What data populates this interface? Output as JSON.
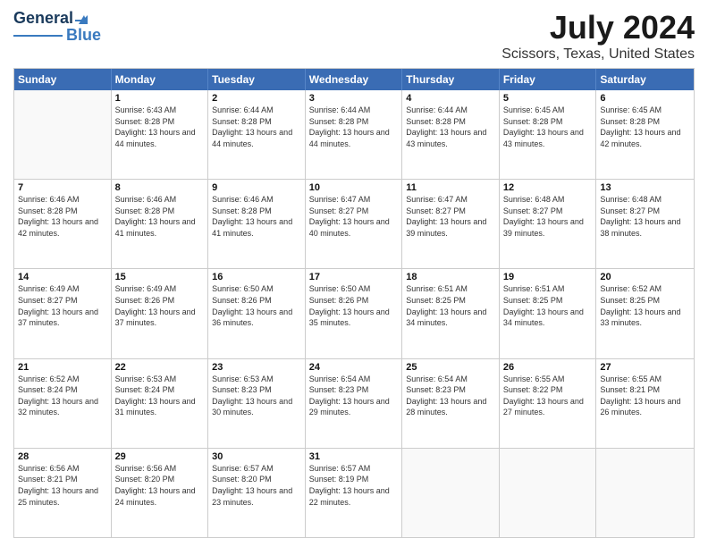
{
  "logo": {
    "line1": "General",
    "line2": "Blue"
  },
  "title": "July 2024",
  "subtitle": "Scissors, Texas, United States",
  "days_of_week": [
    "Sunday",
    "Monday",
    "Tuesday",
    "Wednesday",
    "Thursday",
    "Friday",
    "Saturday"
  ],
  "weeks": [
    [
      {
        "day": "",
        "info": ""
      },
      {
        "day": "1",
        "info": "Sunrise: 6:43 AM\nSunset: 8:28 PM\nDaylight: 13 hours and 44 minutes."
      },
      {
        "day": "2",
        "info": "Sunrise: 6:44 AM\nSunset: 8:28 PM\nDaylight: 13 hours and 44 minutes."
      },
      {
        "day": "3",
        "info": "Sunrise: 6:44 AM\nSunset: 8:28 PM\nDaylight: 13 hours and 44 minutes."
      },
      {
        "day": "4",
        "info": "Sunrise: 6:44 AM\nSunset: 8:28 PM\nDaylight: 13 hours and 43 minutes."
      },
      {
        "day": "5",
        "info": "Sunrise: 6:45 AM\nSunset: 8:28 PM\nDaylight: 13 hours and 43 minutes."
      },
      {
        "day": "6",
        "info": "Sunrise: 6:45 AM\nSunset: 8:28 PM\nDaylight: 13 hours and 42 minutes."
      }
    ],
    [
      {
        "day": "7",
        "info": "Sunrise: 6:46 AM\nSunset: 8:28 PM\nDaylight: 13 hours and 42 minutes."
      },
      {
        "day": "8",
        "info": "Sunrise: 6:46 AM\nSunset: 8:28 PM\nDaylight: 13 hours and 41 minutes."
      },
      {
        "day": "9",
        "info": "Sunrise: 6:46 AM\nSunset: 8:28 PM\nDaylight: 13 hours and 41 minutes."
      },
      {
        "day": "10",
        "info": "Sunrise: 6:47 AM\nSunset: 8:27 PM\nDaylight: 13 hours and 40 minutes."
      },
      {
        "day": "11",
        "info": "Sunrise: 6:47 AM\nSunset: 8:27 PM\nDaylight: 13 hours and 39 minutes."
      },
      {
        "day": "12",
        "info": "Sunrise: 6:48 AM\nSunset: 8:27 PM\nDaylight: 13 hours and 39 minutes."
      },
      {
        "day": "13",
        "info": "Sunrise: 6:48 AM\nSunset: 8:27 PM\nDaylight: 13 hours and 38 minutes."
      }
    ],
    [
      {
        "day": "14",
        "info": "Sunrise: 6:49 AM\nSunset: 8:27 PM\nDaylight: 13 hours and 37 minutes."
      },
      {
        "day": "15",
        "info": "Sunrise: 6:49 AM\nSunset: 8:26 PM\nDaylight: 13 hours and 37 minutes."
      },
      {
        "day": "16",
        "info": "Sunrise: 6:50 AM\nSunset: 8:26 PM\nDaylight: 13 hours and 36 minutes."
      },
      {
        "day": "17",
        "info": "Sunrise: 6:50 AM\nSunset: 8:26 PM\nDaylight: 13 hours and 35 minutes."
      },
      {
        "day": "18",
        "info": "Sunrise: 6:51 AM\nSunset: 8:25 PM\nDaylight: 13 hours and 34 minutes."
      },
      {
        "day": "19",
        "info": "Sunrise: 6:51 AM\nSunset: 8:25 PM\nDaylight: 13 hours and 34 minutes."
      },
      {
        "day": "20",
        "info": "Sunrise: 6:52 AM\nSunset: 8:25 PM\nDaylight: 13 hours and 33 minutes."
      }
    ],
    [
      {
        "day": "21",
        "info": "Sunrise: 6:52 AM\nSunset: 8:24 PM\nDaylight: 13 hours and 32 minutes."
      },
      {
        "day": "22",
        "info": "Sunrise: 6:53 AM\nSunset: 8:24 PM\nDaylight: 13 hours and 31 minutes."
      },
      {
        "day": "23",
        "info": "Sunrise: 6:53 AM\nSunset: 8:23 PM\nDaylight: 13 hours and 30 minutes."
      },
      {
        "day": "24",
        "info": "Sunrise: 6:54 AM\nSunset: 8:23 PM\nDaylight: 13 hours and 29 minutes."
      },
      {
        "day": "25",
        "info": "Sunrise: 6:54 AM\nSunset: 8:23 PM\nDaylight: 13 hours and 28 minutes."
      },
      {
        "day": "26",
        "info": "Sunrise: 6:55 AM\nSunset: 8:22 PM\nDaylight: 13 hours and 27 minutes."
      },
      {
        "day": "27",
        "info": "Sunrise: 6:55 AM\nSunset: 8:21 PM\nDaylight: 13 hours and 26 minutes."
      }
    ],
    [
      {
        "day": "28",
        "info": "Sunrise: 6:56 AM\nSunset: 8:21 PM\nDaylight: 13 hours and 25 minutes."
      },
      {
        "day": "29",
        "info": "Sunrise: 6:56 AM\nSunset: 8:20 PM\nDaylight: 13 hours and 24 minutes."
      },
      {
        "day": "30",
        "info": "Sunrise: 6:57 AM\nSunset: 8:20 PM\nDaylight: 13 hours and 23 minutes."
      },
      {
        "day": "31",
        "info": "Sunrise: 6:57 AM\nSunset: 8:19 PM\nDaylight: 13 hours and 22 minutes."
      },
      {
        "day": "",
        "info": ""
      },
      {
        "day": "",
        "info": ""
      },
      {
        "day": "",
        "info": ""
      }
    ]
  ]
}
